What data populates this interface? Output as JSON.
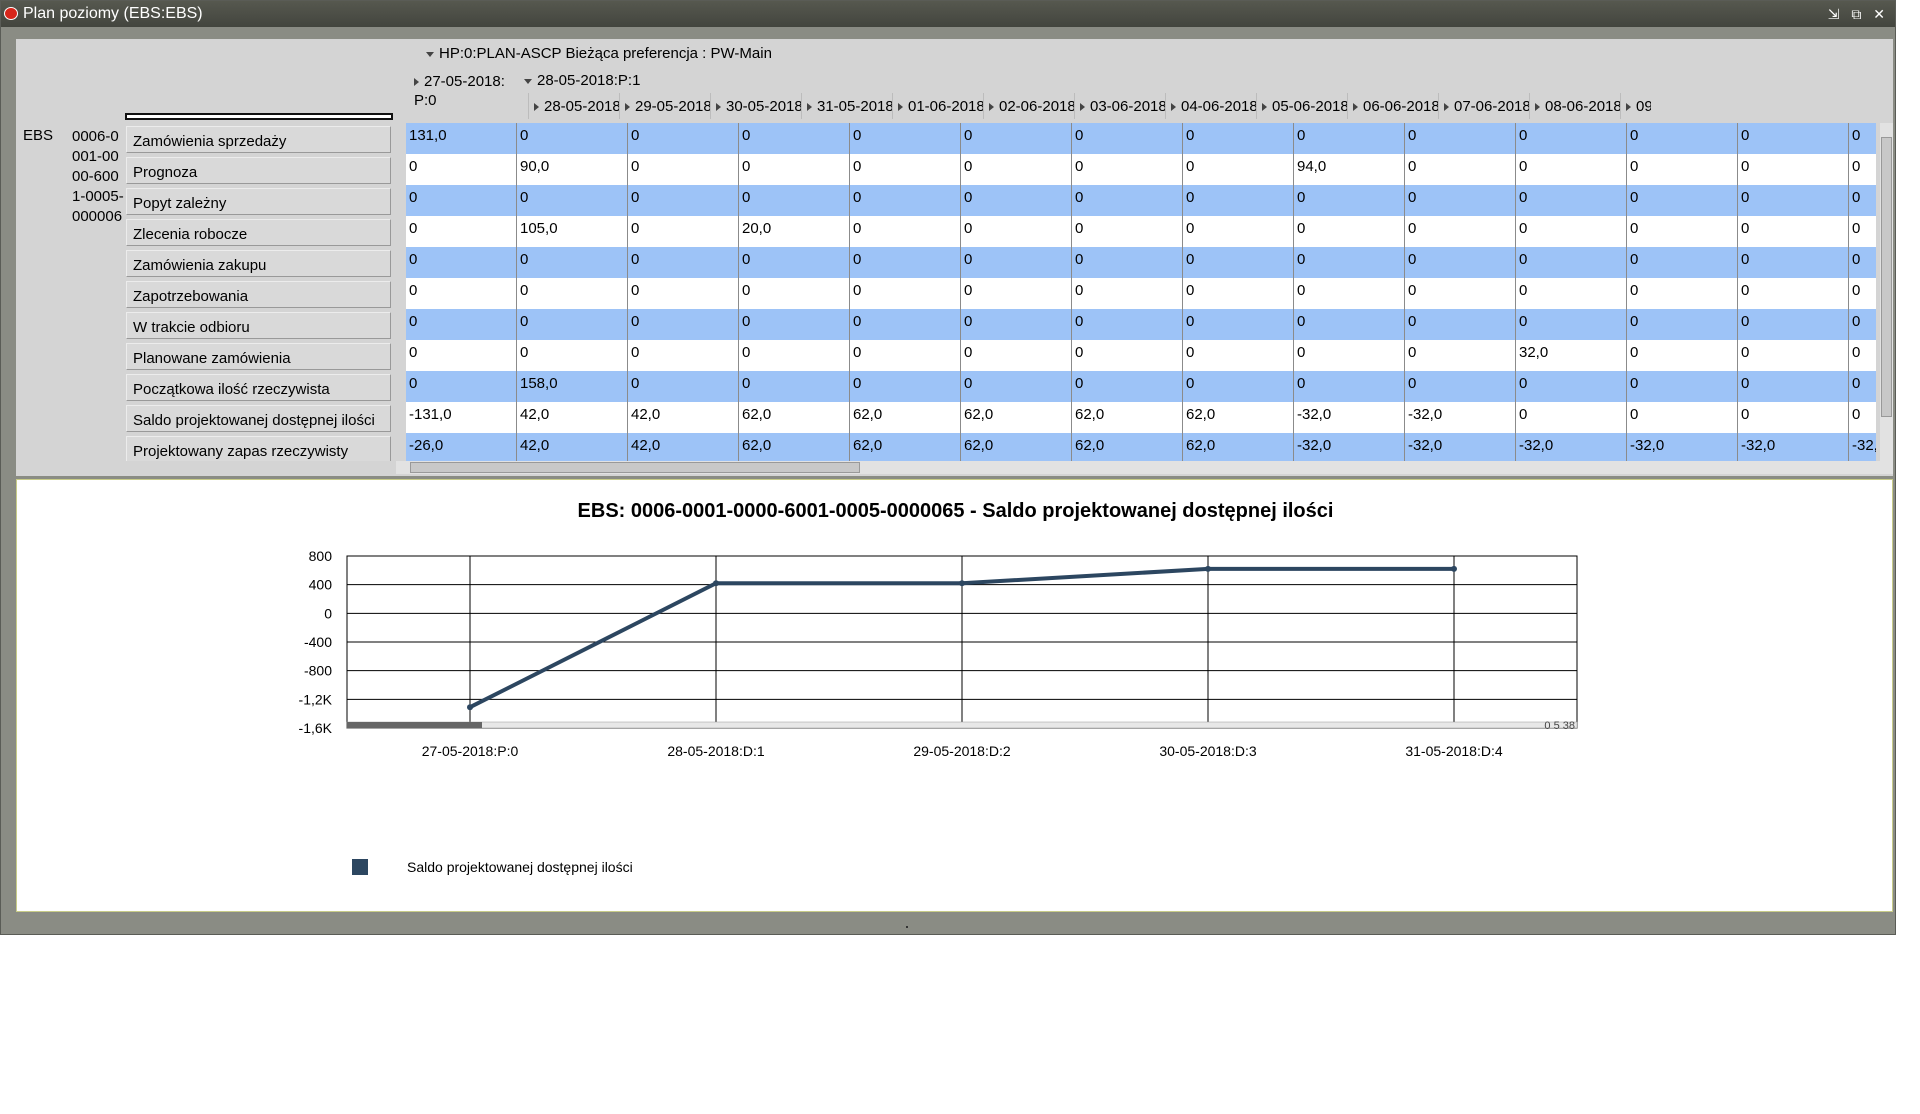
{
  "window": {
    "title": "Plan poziomy (EBS:EBS)",
    "buttons": "⇲ ⧉ ✕"
  },
  "header": {
    "plan_label": "HP:0:PLAN-ASCP  Bieżąca preferencja : PW-Main",
    "period0": "27-05-2018: P:0",
    "period1": "28-05-2018:P:1",
    "date_columns": [
      "28-05-2018...",
      "29-05-2018...",
      "30-05-2018...",
      "31-05-2018...",
      "01-06-2018...",
      "02-06-2018...",
      "03-06-2018...",
      "04-06-2018...",
      "05-06-2018...",
      "06-06-2018...",
      "07-06-2018...",
      "08-06-2018...",
      "09"
    ]
  },
  "org": "EBS",
  "item": "0006-0001-0000-6001-0005-000006",
  "rows": [
    {
      "label": "Zamówienia sprzedaży",
      "values": [
        "131,0",
        "0",
        "0",
        "0",
        "0",
        "0",
        "0",
        "0",
        "0",
        "0",
        "0",
        "0",
        "0",
        "0"
      ]
    },
    {
      "label": "Prognoza",
      "values": [
        "0",
        "90,0",
        "0",
        "0",
        "0",
        "0",
        "0",
        "0",
        "94,0",
        "0",
        "0",
        "0",
        "0",
        "0"
      ]
    },
    {
      "label": "Popyt zależny",
      "values": [
        "0",
        "0",
        "0",
        "0",
        "0",
        "0",
        "0",
        "0",
        "0",
        "0",
        "0",
        "0",
        "0",
        "0"
      ]
    },
    {
      "label": "Zlecenia robocze",
      "values": [
        "0",
        "105,0",
        "0",
        "20,0",
        "0",
        "0",
        "0",
        "0",
        "0",
        "0",
        "0",
        "0",
        "0",
        "0"
      ]
    },
    {
      "label": "Zamówienia zakupu",
      "values": [
        "0",
        "0",
        "0",
        "0",
        "0",
        "0",
        "0",
        "0",
        "0",
        "0",
        "0",
        "0",
        "0",
        "0"
      ]
    },
    {
      "label": "Zapotrzebowania",
      "values": [
        "0",
        "0",
        "0",
        "0",
        "0",
        "0",
        "0",
        "0",
        "0",
        "0",
        "0",
        "0",
        "0",
        "0"
      ]
    },
    {
      "label": "W trakcie odbioru",
      "values": [
        "0",
        "0",
        "0",
        "0",
        "0",
        "0",
        "0",
        "0",
        "0",
        "0",
        "0",
        "0",
        "0",
        "0"
      ]
    },
    {
      "label": "Planowane zamówienia",
      "values": [
        "0",
        "0",
        "0",
        "0",
        "0",
        "0",
        "0",
        "0",
        "0",
        "0",
        "32,0",
        "0",
        "0",
        "0"
      ]
    },
    {
      "label": "Początkowa ilość rzeczywista",
      "values": [
        "0",
        "158,0",
        "0",
        "0",
        "0",
        "0",
        "0",
        "0",
        "0",
        "0",
        "0",
        "0",
        "0",
        "0"
      ]
    },
    {
      "label": "Saldo projektowanej dostępnej ilości",
      "values": [
        "-131,0",
        "42,0",
        "42,0",
        "62,0",
        "62,0",
        "62,0",
        "62,0",
        "62,0",
        "-32,0",
        "-32,0",
        "0",
        "0",
        "0",
        "0"
      ]
    },
    {
      "label": "Projektowany zapas rzeczywisty",
      "values": [
        "-26,0",
        "42,0",
        "42,0",
        "62,0",
        "62,0",
        "62,0",
        "62,0",
        "62,0",
        "-32,0",
        "-32,0",
        "-32,0",
        "-32,0",
        "-32,0",
        "-32,"
      ]
    }
  ],
  "chart_data": {
    "type": "line",
    "title": "EBS: 0006-0001-0000-6001-0005-0000065 - Saldo projektowanej dostępnej ilości",
    "categories": [
      "27-05-2018:P:0",
      "28-05-2018:D:1",
      "29-05-2018:D:2",
      "30-05-2018:D:3",
      "31-05-2018:D:4"
    ],
    "series": [
      {
        "name": "Saldo projektowanej dostępnej ilości",
        "values": [
          -1310,
          420,
          420,
          620,
          620
        ],
        "color": "#2c4660"
      }
    ],
    "yticks": [
      "800",
      "400",
      "0",
      "-400",
      "-800",
      "-1,2K",
      "-1,6K"
    ],
    "ylim": [
      -1600,
      800
    ],
    "grid": true,
    "legend": "bottom-left",
    "scroll_label": "0  5  38"
  }
}
